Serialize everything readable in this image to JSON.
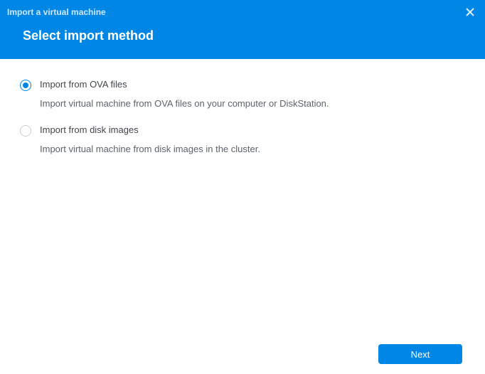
{
  "colors": {
    "primary": "#0086E5"
  },
  "window": {
    "title": "Import a virtual machine"
  },
  "heading": "Select import method",
  "options": [
    {
      "id": "ova",
      "label": "Import from OVA files",
      "description": "Import virtual machine from OVA files on your computer or DiskStation.",
      "selected": true
    },
    {
      "id": "disk",
      "label": "Import from disk images",
      "description": "Import virtual machine from disk images in the cluster.",
      "selected": false
    }
  ],
  "footer": {
    "next_label": "Next"
  }
}
